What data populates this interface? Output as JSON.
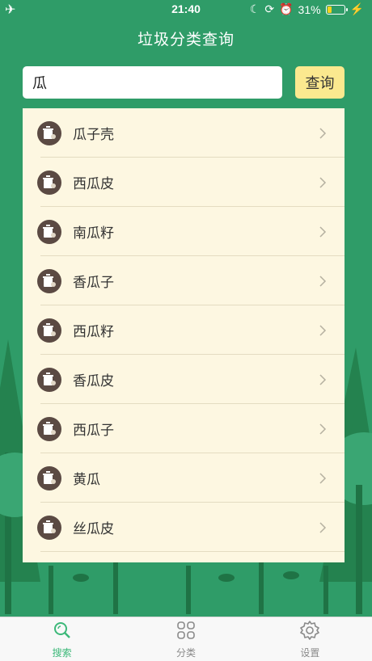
{
  "status_bar": {
    "time": "21:40",
    "battery": "31%",
    "battery_level": 0.31,
    "icons": [
      "airplane-icon",
      "moon-icon",
      "rotation-lock-icon",
      "alarm-icon",
      "battery-icon",
      "charging-icon"
    ]
  },
  "nav": {
    "title": "垃圾分类查询"
  },
  "search": {
    "value": "瓜",
    "button_label": "查询"
  },
  "results": [
    {
      "label": "瓜子壳"
    },
    {
      "label": "西瓜皮"
    },
    {
      "label": "南瓜籽"
    },
    {
      "label": "香瓜子"
    },
    {
      "label": "西瓜籽"
    },
    {
      "label": "香瓜皮"
    },
    {
      "label": "西瓜子"
    },
    {
      "label": "黄瓜"
    },
    {
      "label": "丝瓜皮"
    }
  ],
  "tabs": [
    {
      "label": "搜索",
      "icon": "search-icon",
      "active": true
    },
    {
      "label": "分类",
      "icon": "grid-icon",
      "active": false
    },
    {
      "label": "设置",
      "icon": "gear-icon",
      "active": false
    }
  ],
  "colors": {
    "background": "#2f9c68",
    "list_background": "#fdf7e1",
    "button": "#fbe98f",
    "active_tab": "#3cb879",
    "avatar": "#5b4a43"
  }
}
